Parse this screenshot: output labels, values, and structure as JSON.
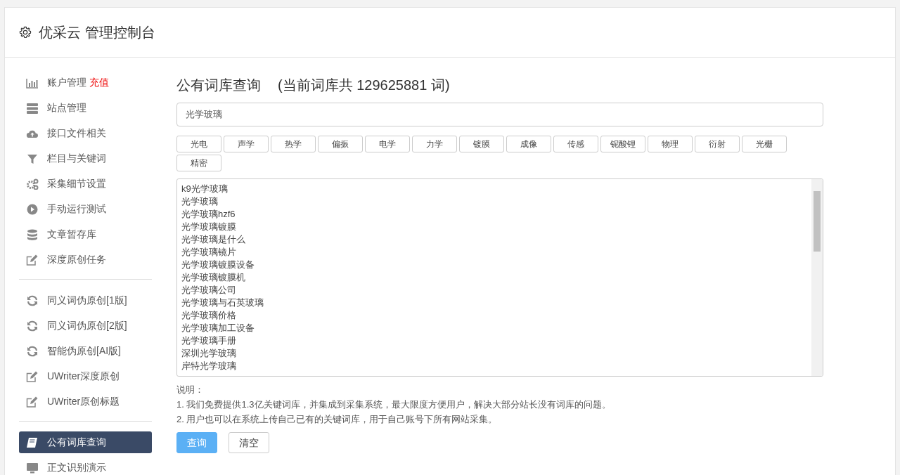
{
  "header": {
    "title": "优采云 管理控制台"
  },
  "sidebar": {
    "groups": [
      {
        "items": [
          {
            "label": "账户管理",
            "tag": "充值",
            "selected": false
          },
          {
            "label": "站点管理",
            "selected": false
          },
          {
            "label": "接口文件相关",
            "selected": false
          },
          {
            "label": "栏目与关键词",
            "selected": false
          },
          {
            "label": "采集细节设置",
            "selected": false
          },
          {
            "label": "手动运行测试",
            "selected": false
          },
          {
            "label": "文章暂存库",
            "selected": false
          },
          {
            "label": "深度原创任务",
            "selected": false
          }
        ]
      },
      {
        "items": [
          {
            "label": "同义词伪原创[1版]",
            "selected": false
          },
          {
            "label": "同义词伪原创[2版]",
            "selected": false
          },
          {
            "label": "智能伪原创[AI版]",
            "selected": false
          },
          {
            "label": "UWriter深度原创",
            "selected": false
          },
          {
            "label": "UWriter原创标题",
            "selected": false
          }
        ]
      },
      {
        "items": [
          {
            "label": "公有词库查询",
            "selected": true
          },
          {
            "label": "正文识别演示",
            "selected": false
          }
        ]
      }
    ]
  },
  "main": {
    "title": "公有词库查询",
    "subtitle": "(当前词库共 129625881 词)",
    "search": {
      "value": "光学玻璃"
    },
    "categories": [
      "光电",
      "声学",
      "热学",
      "偏振",
      "电学",
      "力学",
      "镀膜",
      "成像",
      "传感",
      "铌酸锂",
      "物理",
      "衍射",
      "光栅",
      "精密"
    ],
    "results": [
      "k9光学玻璃",
      "光学玻璃",
      "光学玻璃hzf6",
      "光学玻璃镀膜",
      "光学玻璃是什么",
      "光学玻璃镜片",
      "光学玻璃镀膜设备",
      "光学玻璃镀膜机",
      "光学玻璃公司",
      "光学玻璃与石英玻璃",
      "光学玻璃价格",
      "光学玻璃加工设备",
      "光学玻璃手册",
      "深圳光学玻璃",
      "岸特光学玻璃"
    ],
    "notes_title": "说明：",
    "notes": [
      "1. 我们免费提供1.3亿关键词库，并集成到采集系统，最大限度方便用户，解决大部分站长没有词库的问题。",
      "2. 用户也可以在系统上传自己已有的关键词库，用于自己账号下所有网站采集。"
    ],
    "buttons": [
      {
        "label": "查询",
        "kind": "primary"
      },
      {
        "label": "清空",
        "kind": "secondary"
      }
    ]
  }
}
